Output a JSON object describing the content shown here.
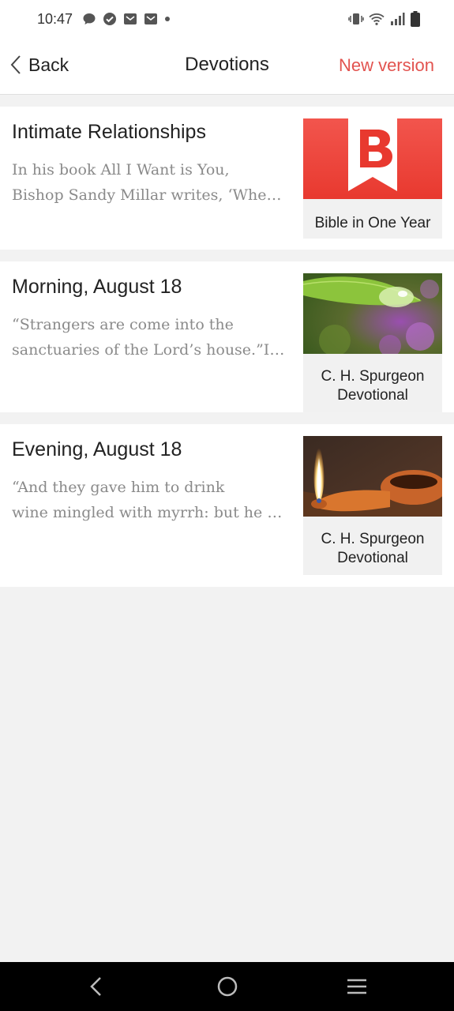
{
  "status_bar": {
    "time": "10:47",
    "icons_left": [
      "chat-icon",
      "check-circle-icon",
      "mail-icon",
      "mail-icon",
      "dot-icon"
    ],
    "icons_right": [
      "vibrate-icon",
      "wifi-icon",
      "signal-icon",
      "battery-icon"
    ]
  },
  "header": {
    "back_label": "Back",
    "title": "Devotions",
    "new_version_label": "New version",
    "accent_color": "#e2534f"
  },
  "devotions": [
    {
      "title": "Intimate Relationships",
      "excerpt_line1": "In his book All I Want is You,",
      "excerpt_line2": "Bishop Sandy Millar writes, ‘When he",
      "source": "Bible in One Year",
      "image": "bible-in-one-year-logo"
    },
    {
      "title": "Morning, August 18",
      "excerpt_line1": "“Strangers are come into the",
      "excerpt_line2": "sanctuaries of the Lord’s house.”It has",
      "source_line1": "C. H. Spurgeon",
      "source_line2": "Devotional",
      "image": "water-drop-leaf-photo"
    },
    {
      "title": "Evening, August 18",
      "excerpt_line1": "“And they gave him to drink",
      "excerpt_line2": "wine mingled with myrrh: but he received",
      "source_line1": "C. H. Spurgeon",
      "source_line2": "Devotional",
      "image": "oil-lamp-photo"
    }
  ],
  "nav_bar": {
    "buttons": [
      "back-nav-icon",
      "home-nav-icon",
      "recents-nav-icon"
    ]
  }
}
